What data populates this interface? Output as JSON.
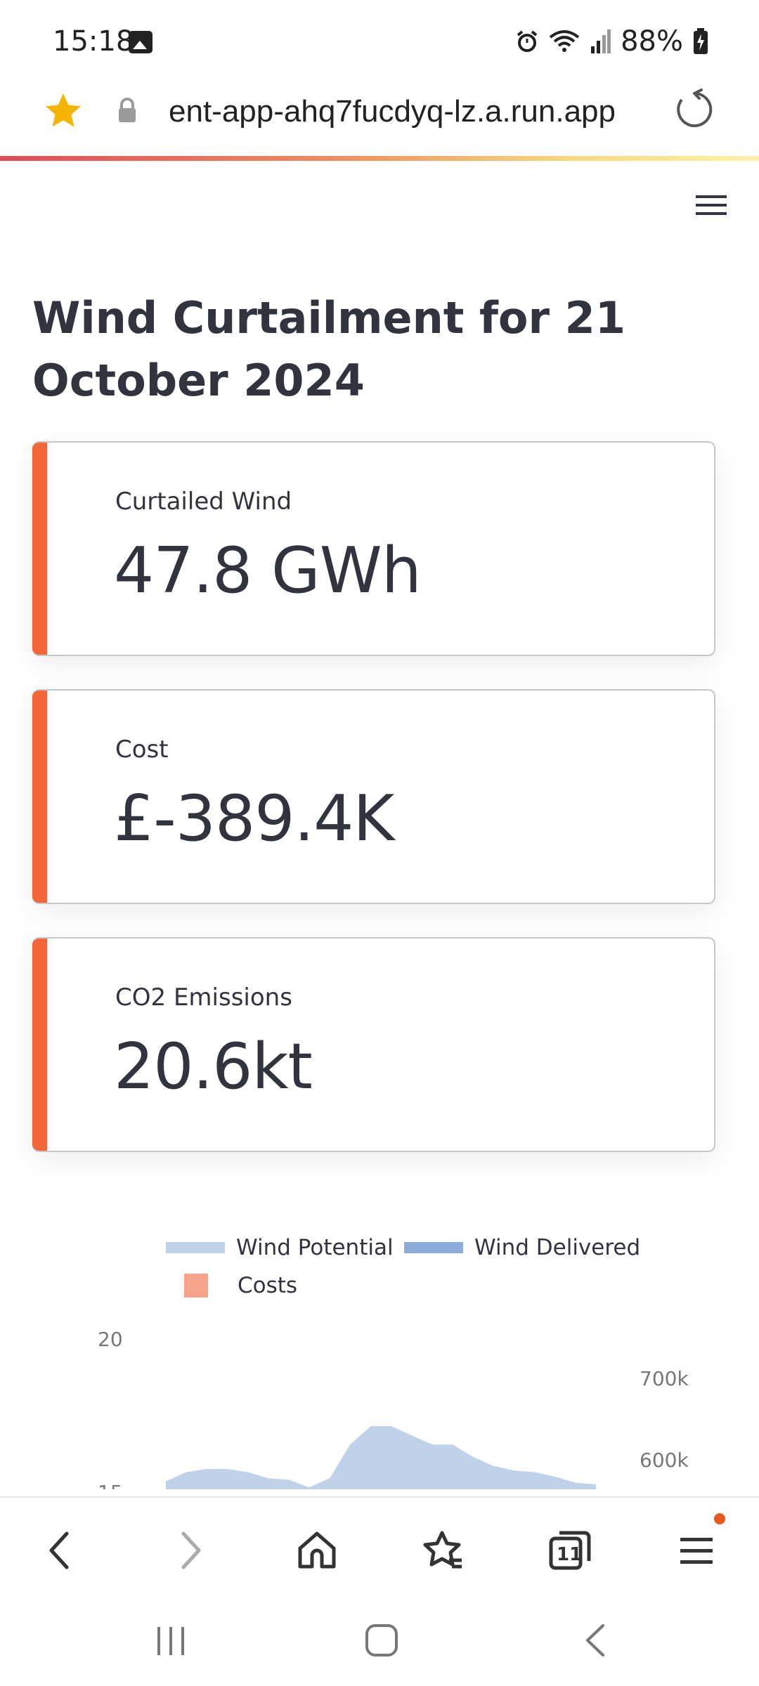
{
  "status_bar": {
    "time": "15:18",
    "battery": "88%",
    "icons": [
      "image-icon",
      "alarm-icon",
      "wifi-icon",
      "signal-icon",
      "battery-charging-icon"
    ]
  },
  "browser": {
    "url": "ent-app-ahq7fucdyq-lz.a.run.app",
    "icons": [
      "bookmark-star-icon",
      "lock-icon",
      "reload-icon"
    ],
    "tab_count": "11"
  },
  "page": {
    "title": "Wind Curtailment for 21 October 2024",
    "metrics": [
      {
        "label": "Curtailed Wind",
        "value": "47.8 GWh"
      },
      {
        "label": "Cost",
        "value": "£-389.4K"
      },
      {
        "label": "CO2 Emissions",
        "value": "20.6kt"
      }
    ],
    "accent_color": "#f4663a"
  },
  "chart_data": {
    "type": "area",
    "legend": [
      {
        "name": "Wind Potential",
        "color": "#c0d2ea"
      },
      {
        "name": "Wind Delivered",
        "color": "#8eaddb"
      },
      {
        "name": "Costs",
        "color": "#f7a389"
      }
    ],
    "y_left_ticks": [
      "20",
      "15"
    ],
    "y_right_ticks": [
      "700k",
      "600k"
    ],
    "series": [
      {
        "name": "Wind Potential",
        "values": [
          15.4,
          15.7,
          15.8,
          15.8,
          15.7,
          15.5,
          15.45,
          15.2,
          15.5,
          16.6,
          17.2,
          17.2,
          16.9,
          16.6,
          16.6,
          16.2,
          15.9,
          15.75,
          15.7,
          15.55,
          15.35,
          15.3
        ]
      }
    ]
  }
}
